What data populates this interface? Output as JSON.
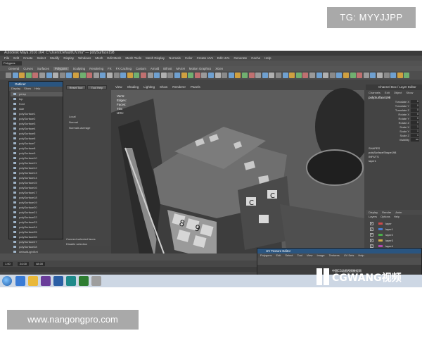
{
  "watermark": {
    "top_right": "TG: MYYJJPP",
    "bottom_left": "www.nangongpro.com"
  },
  "app": {
    "title": "Autodesk Maya 2016 x64: C:\\Users\\Default\\UV.ma* — polySurface198",
    "menus": [
      "File",
      "Edit",
      "Create",
      "Select",
      "Modify",
      "Display",
      "Windows",
      "Mesh",
      "Edit Mesh",
      "Mesh Tools",
      "Mesh Display",
      "Normals",
      "Color",
      "Create UVs",
      "Edit UVs",
      "Generate",
      "Cache",
      "Help"
    ],
    "mode": "Polygons",
    "shelf_tabs": [
      "General",
      "Curves",
      "Surfaces",
      "Polygons",
      "Sculpting",
      "Rendering",
      "FX",
      "FX Caching",
      "Custom",
      "Arnold",
      "Bifrost",
      "MASH",
      "Motion Graphics",
      "XGen"
    ],
    "active_shelf_tab": "Polygons"
  },
  "outliner": {
    "title": "Outliner",
    "menus": [
      "Display",
      "Show",
      "Help"
    ],
    "items": [
      "persp",
      "top",
      "front",
      "side",
      "polySurface1",
      "polySurface2",
      "polySurface3",
      "polySurface4",
      "polySurface5",
      "polySurface6",
      "polySurface7",
      "polySurface8",
      "polySurface9",
      "polySurface10",
      "polySurface11",
      "polySurface12",
      "polySurface13",
      "polySurface14",
      "polySurface15",
      "polySurface16",
      "polySurface17",
      "polySurface18",
      "polySurface19",
      "polySurface20",
      "polySurface21",
      "polySurface22",
      "polySurface23",
      "polySurface24",
      "polySurface25",
      "polySurface26",
      "polySurface27",
      "polySurface28",
      "defaultLightSet"
    ],
    "selected_index": 0
  },
  "left_panel": {
    "options": [
      "Local",
      "Normal",
      "Normals average"
    ],
    "buttons": [
      "Reset Tool",
      "Tool Help"
    ],
    "footer": [
      "Connect selected faces",
      "Disable selection",
      "Soft Selection"
    ]
  },
  "viewport": {
    "menus": [
      "View",
      "Shading",
      "Lighting",
      "Show",
      "Renderer",
      "Panels"
    ],
    "stats": [
      "Verts:",
      "Edges:",
      "Faces:",
      "Tris:",
      "UVs:"
    ],
    "camera_label": "persp"
  },
  "channel_box": {
    "title": "Channel Box / Layer Editor",
    "tabs": [
      "Channels",
      "Edit",
      "Object",
      "Show"
    ],
    "object": "polySurface198",
    "attributes": [
      {
        "name": "Translate X",
        "value": "0"
      },
      {
        "name": "Translate Y",
        "value": "0"
      },
      {
        "name": "Translate Z",
        "value": "0"
      },
      {
        "name": "Rotate X",
        "value": "0"
      },
      {
        "name": "Rotate Y",
        "value": "0"
      },
      {
        "name": "Rotate Z",
        "value": "0"
      },
      {
        "name": "Scale X",
        "value": "1"
      },
      {
        "name": "Scale Y",
        "value": "1"
      },
      {
        "name": "Scale Z",
        "value": "1"
      },
      {
        "name": "Visibility",
        "value": "on"
      }
    ],
    "sections": [
      "SHAPES",
      "polySurfaceShape198",
      "INPUTS",
      "layer1"
    ],
    "layer_tabs": [
      "Display",
      "Render",
      "Anim"
    ],
    "layer_menus": [
      "Layers",
      "Options",
      "Help"
    ],
    "layers": [
      {
        "name": "layer",
        "color": "#d04a4a"
      },
      {
        "name": "layer1",
        "color": "#4a7cd0"
      },
      {
        "name": "layer2",
        "color": "#4ab04a"
      },
      {
        "name": "layer3",
        "color": "#d0b04a"
      },
      {
        "name": "layer4",
        "color": "#b04ab0"
      }
    ]
  },
  "uv_editor": {
    "title": "UV Texture Editor",
    "menus": [
      "Polygons",
      "Edit",
      "Select",
      "Tool",
      "View",
      "Image",
      "Textures",
      "UV Sets",
      "Help"
    ]
  },
  "timeline": {
    "start": "1.00",
    "end": "24.00",
    "range_end": "48.00"
  },
  "logo": {
    "text": "CGWANG视频",
    "subtext": "中国CG动画视频教程网"
  }
}
